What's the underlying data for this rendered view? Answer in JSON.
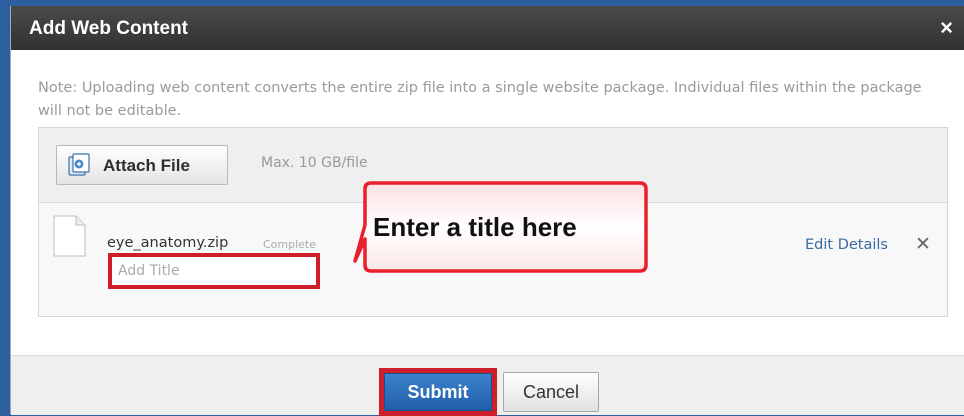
{
  "dialog": {
    "title": "Add Web Content",
    "close_label": "×",
    "note": "Note: Uploading web content converts the entire zip file into a single website package. Individual files within the package will not be editable."
  },
  "attach": {
    "button_label": "Attach File",
    "max_size": "Max. 10 GB/file"
  },
  "file": {
    "name": "eye_anatomy.zip",
    "status": "Complete",
    "title_placeholder": "Add Title",
    "edit_details": "Edit Details",
    "remove_label": "✕"
  },
  "callout": {
    "text": "Enter a title here",
    "color": "#e8202c"
  },
  "footer": {
    "submit_label": "Submit",
    "cancel_label": "Cancel"
  },
  "colors": {
    "titlebar": "#3a3a3a",
    "highlight": "#cc1f2a",
    "link": "#3a6aa5",
    "submit": "#2a6db8"
  }
}
